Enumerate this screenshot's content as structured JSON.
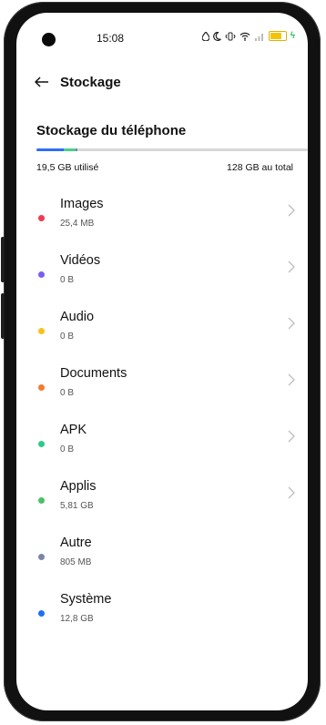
{
  "status_bar": {
    "time": "15:08",
    "icons": [
      "water-drop-icon",
      "moon-icon",
      "vibrate-icon",
      "wifi-icon",
      "signal-icon",
      "battery-charging-icon"
    ]
  },
  "header": {
    "title": "Stockage",
    "back_icon": "back-arrow-icon"
  },
  "storage": {
    "section_title": "Stockage du téléphone",
    "used": "19,5  GB utilisé",
    "total": "128 GB au total",
    "usage_fraction": 0.152,
    "usage_breakdown": [
      {
        "color": "#2f6df6",
        "fraction": 0.1
      },
      {
        "color": "#4ad08a",
        "fraction": 0.045
      },
      {
        "color": "#7a86a8",
        "fraction": 0.007
      }
    ]
  },
  "categories": [
    {
      "label": "Images",
      "size": "25,4 MB",
      "color": "#ef3b4f",
      "has_chevron": true
    },
    {
      "label": "Vidéos",
      "size": "0 B",
      "color": "#7b5cf0",
      "has_chevron": true
    },
    {
      "label": "Audio",
      "size": "0 B",
      "color": "#f7c21a",
      "has_chevron": true
    },
    {
      "label": "Documents",
      "size": "0 B",
      "color": "#f27c2c",
      "has_chevron": true
    },
    {
      "label": "APK",
      "size": "0 B",
      "color": "#2fc98a",
      "has_chevron": true
    },
    {
      "label": "Applis",
      "size": "5,81  GB",
      "color": "#4ac16a",
      "has_chevron": true
    },
    {
      "label": "Autre",
      "size": "805 MB",
      "color": "#7a86a8",
      "has_chevron": false
    },
    {
      "label": "Système",
      "size": "12,8 GB",
      "color": "#1f6ff2",
      "has_chevron": false
    }
  ]
}
